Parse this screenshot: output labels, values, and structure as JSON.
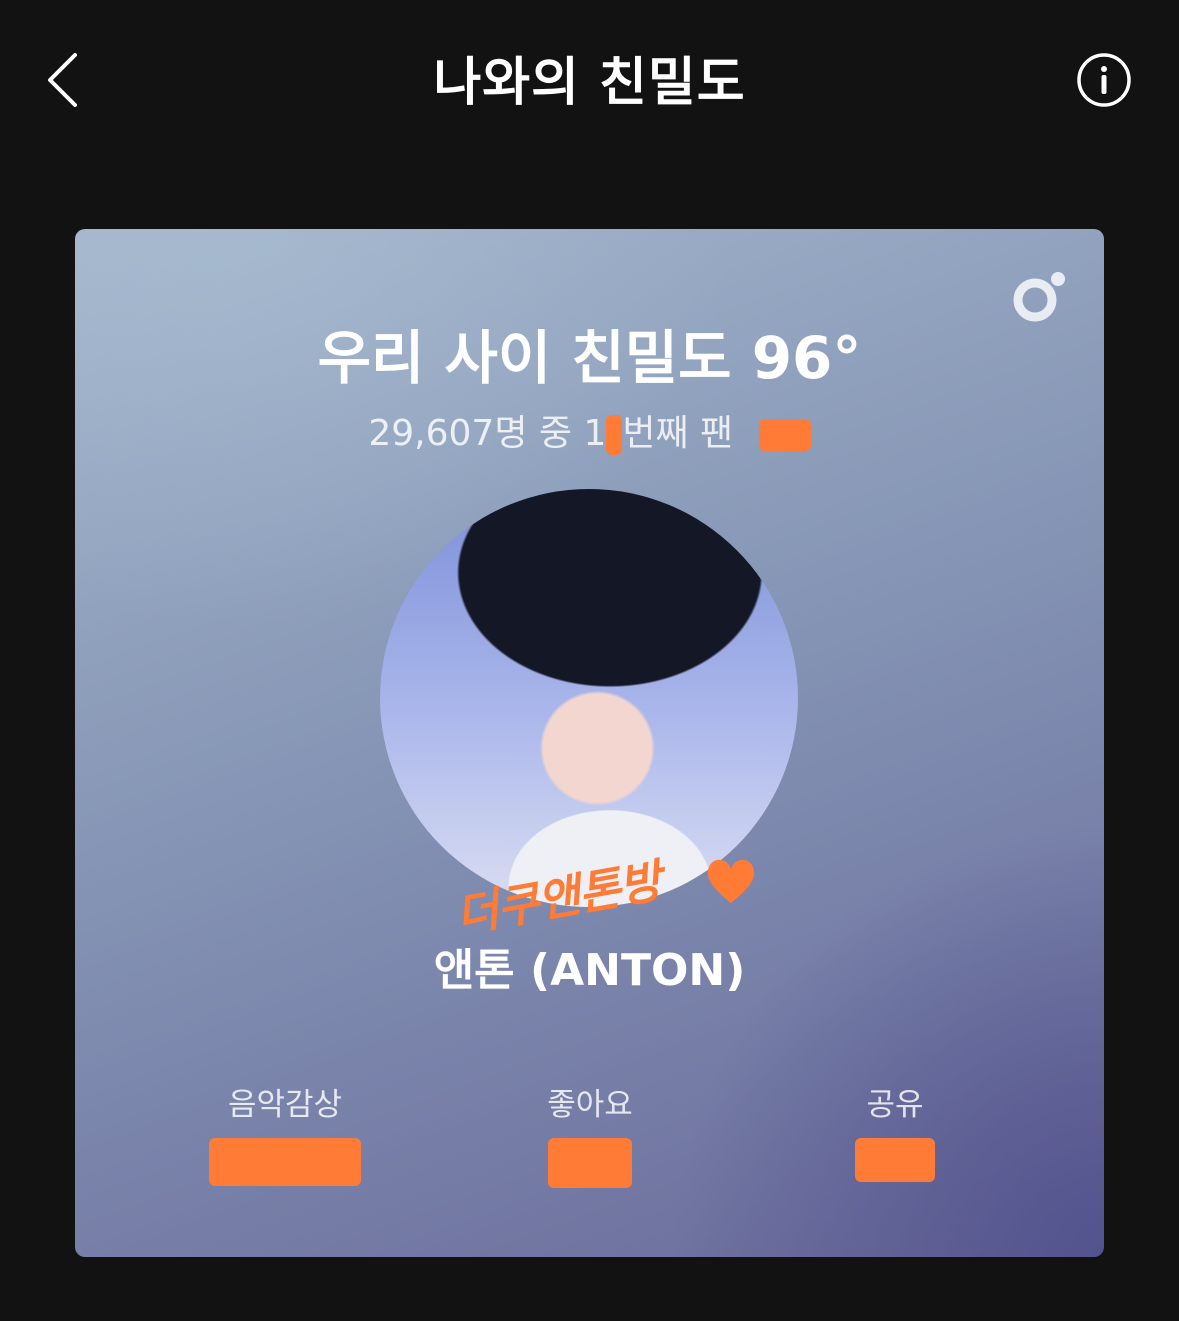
{
  "header": {
    "title": "나와의 친밀도",
    "back_icon": "chevron-left-icon",
    "info_icon": "info-icon"
  },
  "card": {
    "headline": "우리 사이 친밀도 96°",
    "subline_prefix": "29,607명 중 1",
    "subline_suffix": "번째 팬",
    "sticker_text": "더쿠앤톤방",
    "artist_name": "앤톤 (ANTON)",
    "stats": [
      {
        "label": "음악감상"
      },
      {
        "label": "좋아요"
      },
      {
        "label": "공유"
      }
    ],
    "colors": {
      "redaction": "#ff7b36",
      "background": "#121212"
    }
  }
}
